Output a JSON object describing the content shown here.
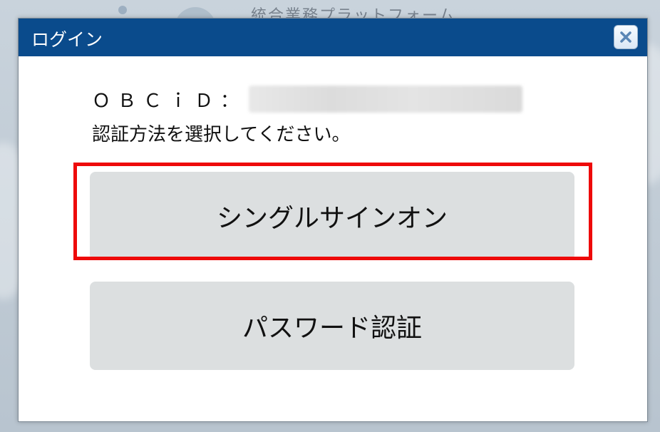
{
  "background": {
    "page_title": "統合業務プラットフォーム"
  },
  "dialog": {
    "title": "ログイン",
    "close_icon": "close-icon",
    "obcid_label": "ＯＢＣｉＤ：",
    "instruction": "認証方法を選択してください。",
    "buttons": {
      "sso_label": "シングルサインオン",
      "password_label": "パスワード認証"
    }
  },
  "colors": {
    "header": "#0a4b8c",
    "button_bg": "#dcdfe0",
    "highlight": "#ee0a0a"
  }
}
